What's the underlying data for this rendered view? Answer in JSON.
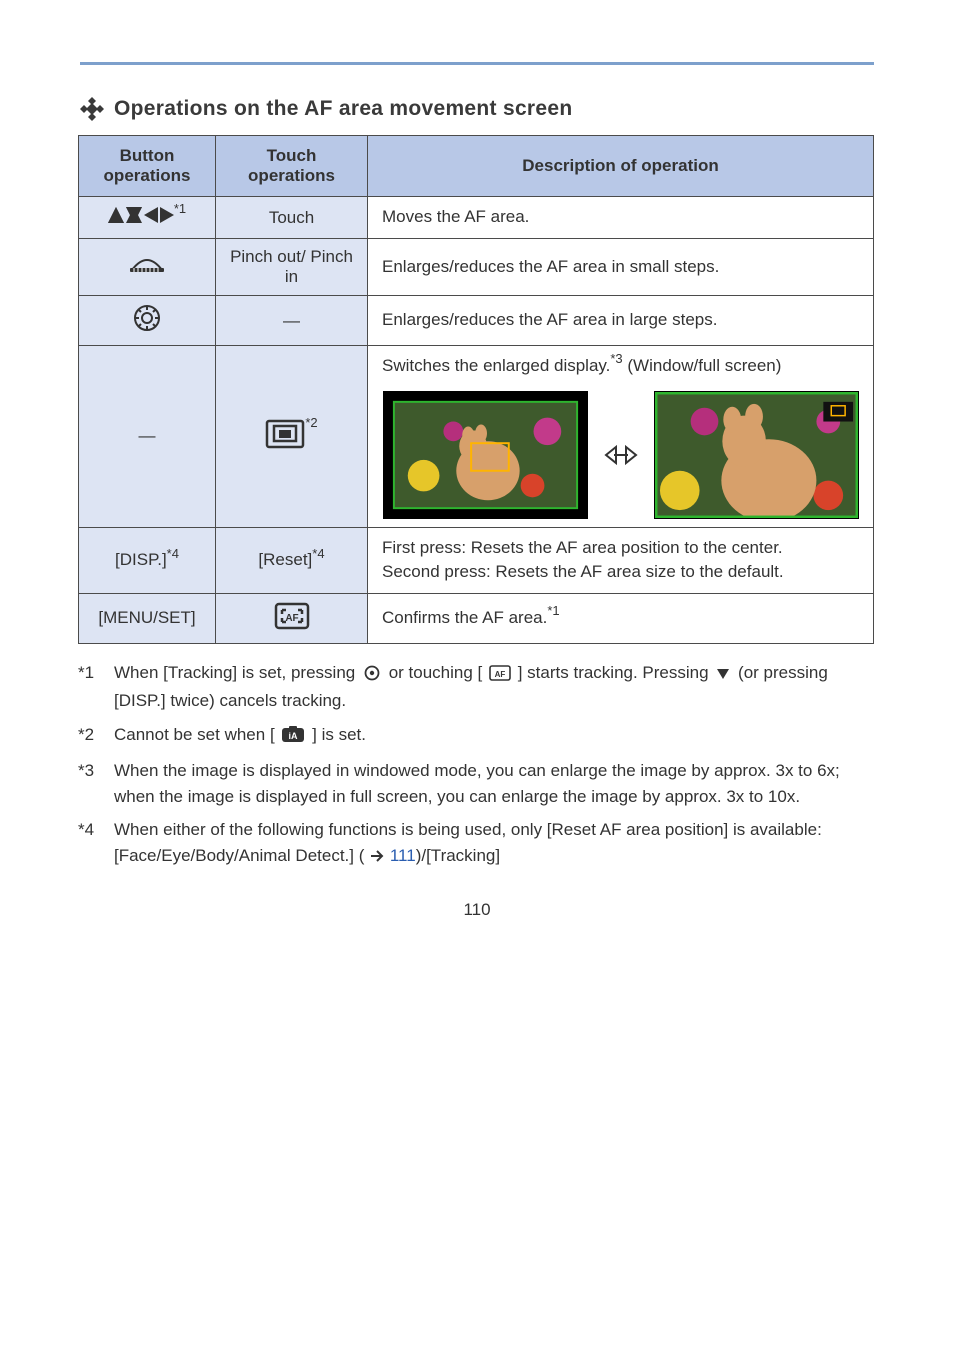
{
  "heading": "Operations on the AF area movement screen",
  "table": {
    "headers": [
      "Button operations",
      "Touch operations",
      "Description of operation"
    ],
    "rows": [
      {
        "left_icon": "cursor-arrows-icon",
        "left_sup": "*1",
        "mid_text": "Touch",
        "desc_pre": "Moves the AF area."
      },
      {
        "left_icon": "front-dial-icon",
        "mid_text": "Pinch out/ Pinch in",
        "desc_pre": "Enlarges/reduces the AF area in small steps."
      },
      {
        "left_icon": "rear-dial-icon",
        "mid_text": "—",
        "desc_pre": "Enlarges/reduces the AF area in large steps."
      },
      {
        "left_text": "—",
        "mid_icon": "enlarge-button-icon",
        "mid_sup": "*2",
        "desc_pre": "Switches the enlarged display.",
        "desc_post": " (Window/full screen)",
        "desc_sup": "*3"
      },
      {
        "left_text": "[DISP.]",
        "left_sup": "*4",
        "mid_text": "[Reset]",
        "mid_sup": "*4",
        "desc_pre": "First press: Resets the AF area position to the center.\nSecond press: Resets the AF area size to the default."
      },
      {
        "left_text": "[MENU/SET]",
        "mid_icon": "af-confirm-button-icon",
        "desc_pre": "Confirms the AF area.",
        "desc_sup": "*1"
      }
    ]
  },
  "footnotes": {
    "f1": {
      "key": "*1",
      "text_before": "When [Tracking] is set, pressing ",
      "icon": "menu-set-icon",
      "text_mid": " or touching [",
      "icon2": "af-confirm-button-icon",
      "text_after": "] starts tracking. Pressing ",
      "icon3": "down-triangle-icon",
      "text_end": " (or pressing [DISP.] twice) cancels tracking."
    },
    "f2": {
      "key": "*2",
      "text_before": "Cannot be set when [",
      "icon": "ia-mode-icon",
      "text_after": "] is set."
    },
    "f3": {
      "key": "*3",
      "text": "When the image is displayed in windowed mode, you can enlarge the image by approx. 3x to 6x; when the image is displayed in full screen, you can enlarge the image by approx. 3x to 10x."
    },
    "f4": {
      "key": "*4",
      "text_before": "When either of the following functions is being used, only [Reset AF area position] is available: [Face/Eye/Body/Animal Detect.] (",
      "link": "111",
      "text_after": ")/[Tracking]"
    }
  },
  "page_number": "110"
}
